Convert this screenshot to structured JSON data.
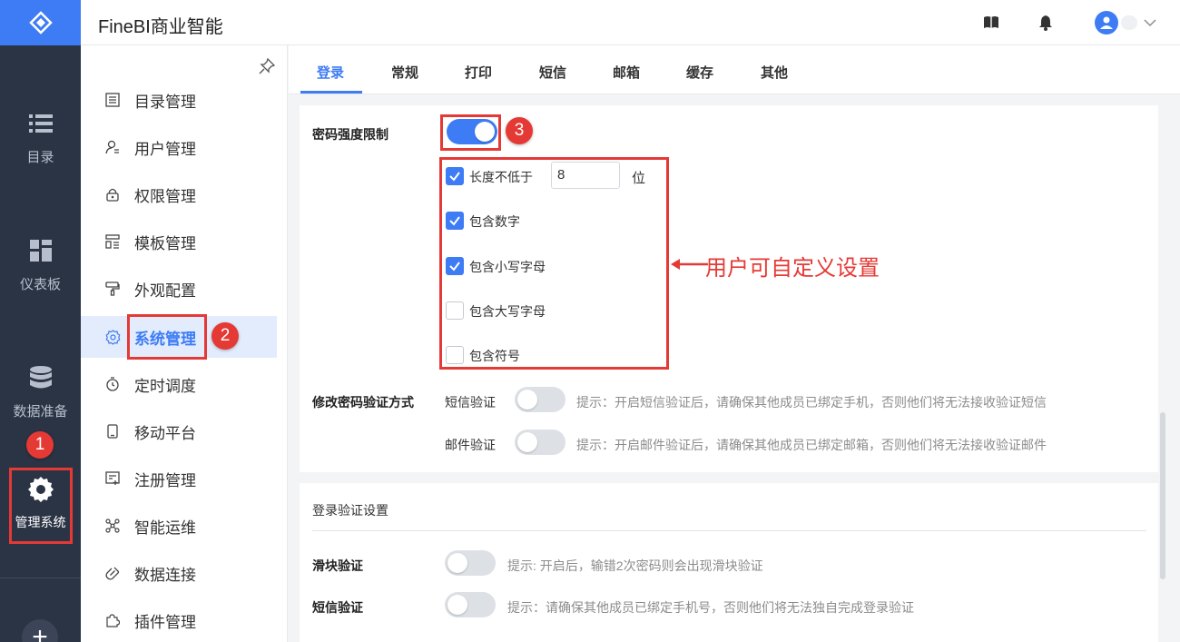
{
  "app": {
    "title": "FineBI商业智能"
  },
  "rail": {
    "items": [
      {
        "label": "目录",
        "icon": "list-icon"
      },
      {
        "label": "仪表板",
        "icon": "dashboard-icon"
      },
      {
        "label": "数据准备",
        "icon": "database-icon"
      },
      {
        "label": "管理系统",
        "icon": "gear-icon",
        "active": true
      }
    ]
  },
  "sidebar": {
    "items": [
      {
        "label": "目录管理",
        "icon": "catalog-icon"
      },
      {
        "label": "用户管理",
        "icon": "user-icon"
      },
      {
        "label": "权限管理",
        "icon": "lock-icon"
      },
      {
        "label": "模板管理",
        "icon": "template-icon"
      },
      {
        "label": "外观配置",
        "icon": "brush-icon"
      },
      {
        "label": "系统管理",
        "icon": "settings-icon",
        "active": true
      },
      {
        "label": "定时调度",
        "icon": "timer-icon"
      },
      {
        "label": "移动平台",
        "icon": "mobile-icon"
      },
      {
        "label": "注册管理",
        "icon": "register-icon"
      },
      {
        "label": "智能运维",
        "icon": "network-icon"
      },
      {
        "label": "数据连接",
        "icon": "link-icon"
      },
      {
        "label": "插件管理",
        "icon": "puzzle-icon"
      }
    ]
  },
  "tabs": [
    "登录",
    "常规",
    "打印",
    "短信",
    "邮箱",
    "缓存",
    "其他"
  ],
  "password": {
    "label": "密码强度限制",
    "enabled": true,
    "length_label": "长度不低于",
    "length_value": "8",
    "length_unit": "位",
    "options": [
      {
        "label": "包含数字",
        "checked": true
      },
      {
        "label": "包含小写字母",
        "checked": true
      },
      {
        "label": "包含大写字母",
        "checked": false
      },
      {
        "label": "包含符号",
        "checked": false
      }
    ],
    "length_checked": true
  },
  "change_verify": {
    "label": "修改密码验证方式",
    "rows": [
      {
        "label": "短信验证",
        "enabled": false,
        "hint": "提示：开启短信验证后，请确保其他成员已绑定手机，否则他们将无法接收验证短信"
      },
      {
        "label": "邮件验证",
        "enabled": false,
        "hint": "提示：开启邮件验证后，请确保其他成员已绑定邮箱，否则他们将无法接收验证邮件"
      }
    ]
  },
  "login_verify": {
    "section_title": "登录验证设置",
    "rows": [
      {
        "label": "滑块验证",
        "enabled": false,
        "hint": "提示: 开启后，输错2次密码则会出现滑块验证"
      },
      {
        "label": "短信验证",
        "enabled": false,
        "hint": "提示：请确保其他成员已绑定手机号，否则他们将无法独自完成登录验证"
      }
    ]
  },
  "annotations": {
    "badges": [
      "1",
      "2",
      "3"
    ],
    "note": "用户可自定义设置",
    "color": "#e53935"
  },
  "colors": {
    "accent": "#3d7cf4",
    "rail": "#2b3445"
  }
}
